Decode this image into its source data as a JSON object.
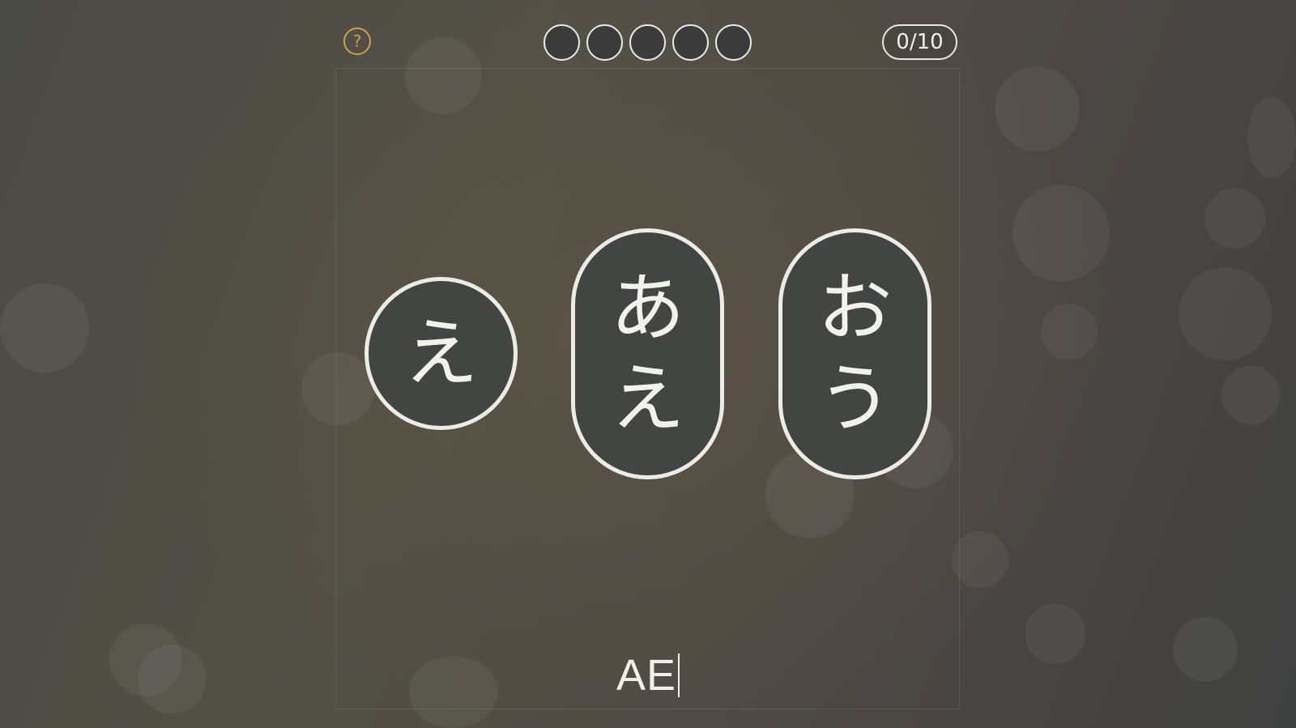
{
  "topbar": {
    "help_label": "?",
    "progress_dots": [
      {
        "filled": false
      },
      {
        "filled": false
      },
      {
        "filled": false
      },
      {
        "filled": false
      },
      {
        "filled": false
      }
    ],
    "counter": "0/10"
  },
  "tiles": [
    {
      "kana": [
        "え"
      ]
    },
    {
      "kana": [
        "あ",
        "え"
      ]
    },
    {
      "kana": [
        "お",
        "う"
      ]
    }
  ],
  "answer": {
    "text": "AE"
  },
  "colors": {
    "accent_help": "#c9a24a",
    "outline": "#ecebe6",
    "tile_fill": "#434543"
  }
}
